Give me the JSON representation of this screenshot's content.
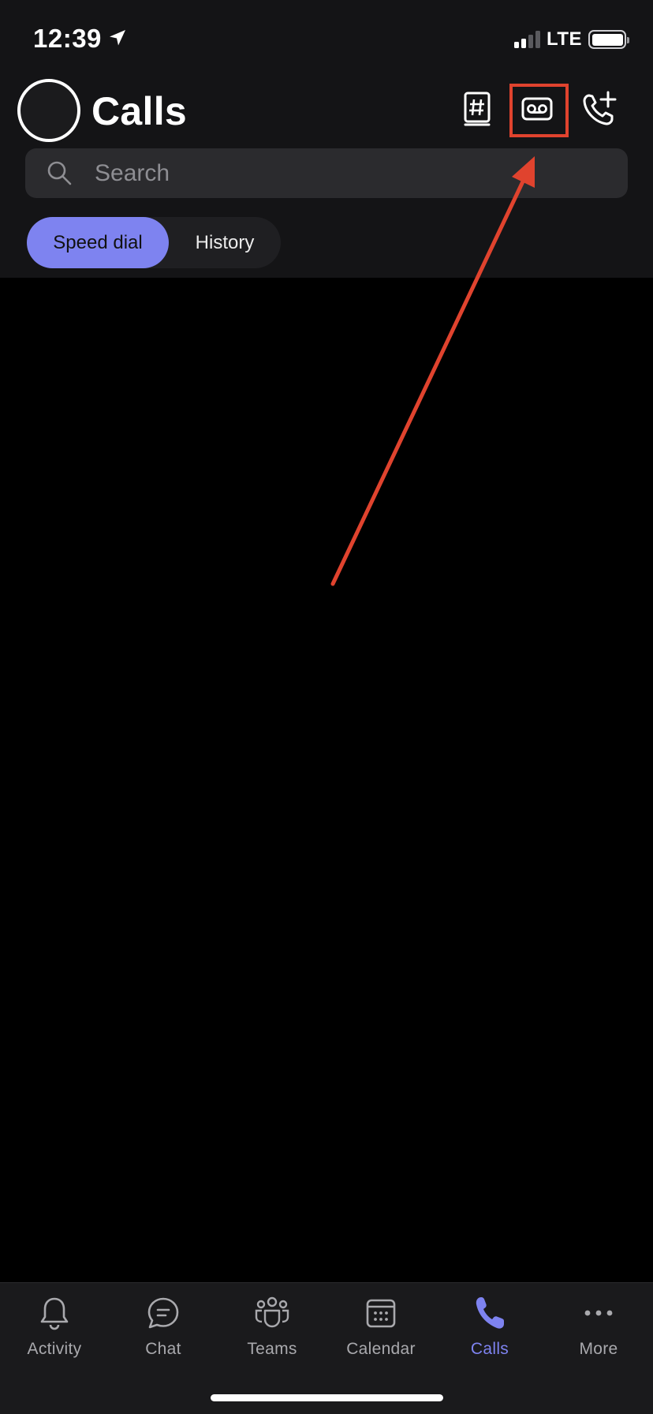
{
  "status_bar": {
    "time": "12:39",
    "network": "LTE",
    "location_icon": "location-arrow-icon",
    "signal_bars_filled": 2,
    "signal_bars_total": 4
  },
  "header": {
    "title": "Calls",
    "icons": [
      "dialpad-icon",
      "voicemail-icon",
      "new-call-icon"
    ]
  },
  "search": {
    "placeholder": "Search"
  },
  "tabs": [
    {
      "label": "Speed dial",
      "selected": true
    },
    {
      "label": "History",
      "selected": false
    }
  ],
  "bottom_nav": [
    {
      "label": "Activity",
      "icon": "bell-icon",
      "active": false
    },
    {
      "label": "Chat",
      "icon": "chat-icon",
      "active": false
    },
    {
      "label": "Teams",
      "icon": "teams-icon",
      "active": false
    },
    {
      "label": "Calendar",
      "icon": "calendar-icon",
      "active": false
    },
    {
      "label": "Calls",
      "icon": "phone-icon",
      "active": true
    },
    {
      "label": "More",
      "icon": "more-icon",
      "active": false
    }
  ],
  "colors": {
    "accent": "#7e83f0",
    "annotation": "#e0432e",
    "background": "#000000",
    "header_bg": "#141416"
  }
}
